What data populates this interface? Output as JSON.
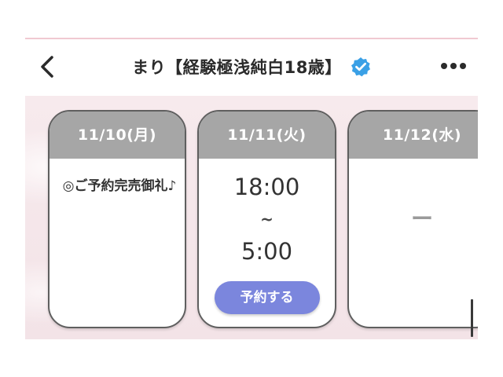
{
  "header": {
    "title": "まり【経験極浅純白18歳】",
    "back_icon": "chevron-left-icon",
    "verified_icon": "verified-badge-icon",
    "more_icon": "more-horizontal-icon"
  },
  "schedule": [
    {
      "date": "11/10(月)",
      "note": "◎ご予約完売御礼♪"
    },
    {
      "date": "11/11(火)",
      "start": "18:00",
      "separator": "~",
      "end": "5:00",
      "button_label": "予約する"
    },
    {
      "date": "11/12(水)",
      "status": "ー"
    }
  ],
  "colors": {
    "card_header": "#a6a6a6",
    "reserve_button": "#7b86dd",
    "verified_badge": "#3aa0e6",
    "background": "#f5e9ec"
  }
}
